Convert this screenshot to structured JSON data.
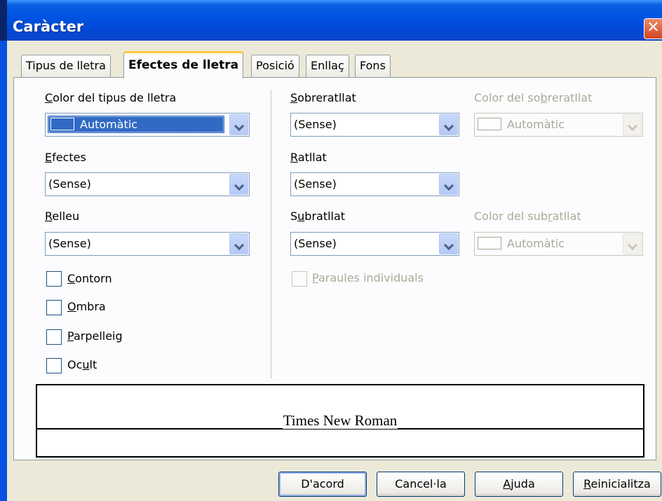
{
  "dialog": {
    "title": "Caràcter",
    "close_label": "✕"
  },
  "tabs": [
    {
      "label": "Tipus de lletra",
      "active": false
    },
    {
      "label": "Efectes de lletra",
      "active": true
    },
    {
      "label": "Posició",
      "active": false
    },
    {
      "label": "Enllaç",
      "active": false
    },
    {
      "label": "Fons",
      "active": false
    }
  ],
  "left": {
    "font_color": {
      "label_pre": "",
      "label_u": "C",
      "label_post": "olor del tipus de lletra",
      "value": "Automàtic"
    },
    "effects": {
      "label_pre": "",
      "label_u": "E",
      "label_post": "fectes",
      "value": "(Sense)"
    },
    "relief": {
      "label_pre": "",
      "label_u": "R",
      "label_post": "elleu",
      "value": "(Sense)"
    },
    "checkboxes": {
      "outline": {
        "pre": "",
        "u": "C",
        "post": "ontorn",
        "checked": false
      },
      "shadow": {
        "pre": "",
        "u": "O",
        "post": "mbra",
        "checked": false
      },
      "blinking": {
        "pre": "",
        "u": "P",
        "post": "arpelleig",
        "checked": false
      },
      "hidden": {
        "pre": "Oc",
        "u": "u",
        "post": "lt",
        "checked": false
      }
    }
  },
  "right": {
    "overline": {
      "label_pre": "",
      "label_u": "S",
      "label_post": "obreratllat",
      "value": "(Sense)"
    },
    "overline_color": {
      "label_pre": "Color del so",
      "label_u": "b",
      "label_post": "reratllat",
      "value": "Automàtic",
      "enabled": false
    },
    "strikethrough": {
      "label_pre": "",
      "label_u": "R",
      "label_post": "atllat",
      "value": "(Sense)"
    },
    "underline": {
      "label_pre": "S",
      "label_u": "u",
      "label_post": "bratllat",
      "value": "(Sense)"
    },
    "underline_color": {
      "label_pre": "Color del sub",
      "label_u": "r",
      "label_post": "atllat",
      "value": "Automàtic",
      "enabled": false
    },
    "individual_words": {
      "pre": "",
      "u": "P",
      "post": "araules individuals",
      "checked": false,
      "enabled": false
    }
  },
  "preview": {
    "sample_text": "Times New Roman"
  },
  "buttons": {
    "ok": {
      "label": "D'acord"
    },
    "cancel": {
      "label": "Cancel·la"
    },
    "help": {
      "pre": "",
      "u": "A",
      "post": "juda"
    },
    "reset": {
      "pre": "",
      "u": "R",
      "post": "einicialitza"
    }
  },
  "colors": {
    "titlebar": "#0054e3",
    "selection": "#316ac5",
    "face": "#ece9d8",
    "tab_highlight": "#ffc83c"
  }
}
